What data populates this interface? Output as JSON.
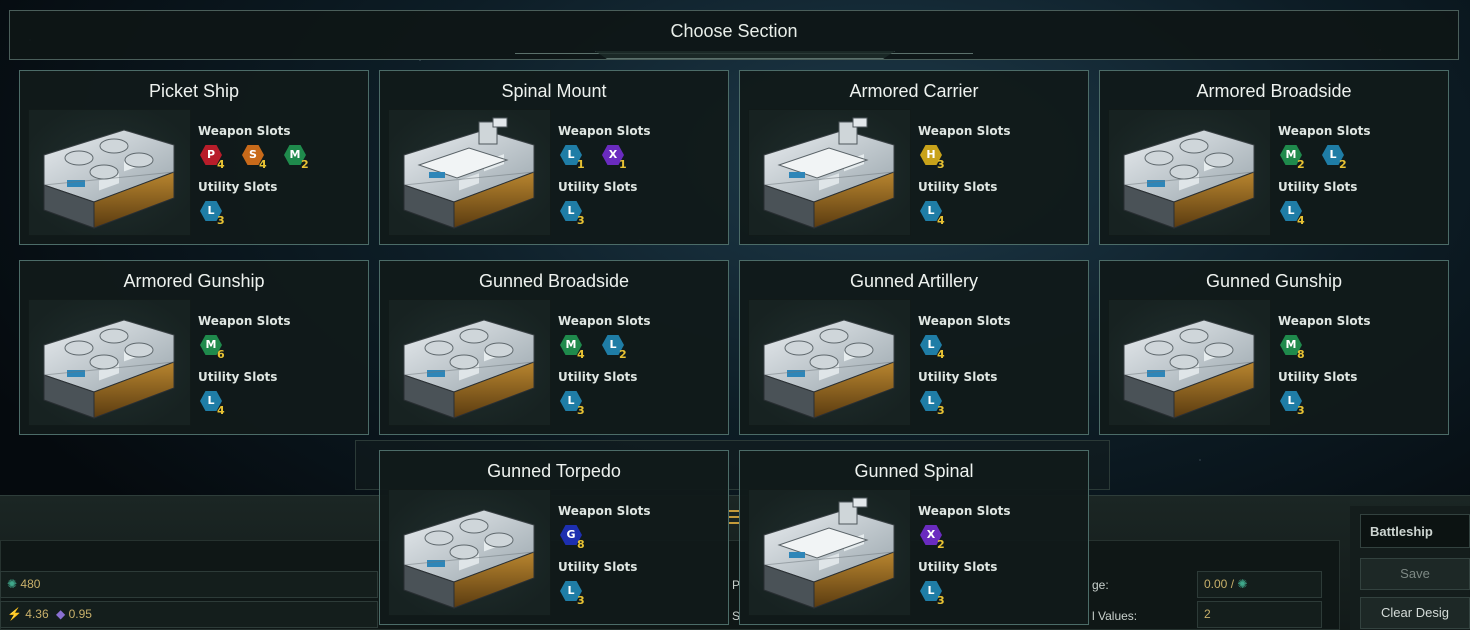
{
  "colors": {
    "P": "#b81d2a",
    "S": "#c86a1a",
    "M": "#1f8a4c",
    "L": "#1f7da6",
    "X": "#6a2bbf",
    "H": "#c8a21a",
    "G": "#1d2fb0"
  },
  "header": {
    "title": "Choose Section"
  },
  "labels": {
    "weapon_slots": "Weapon Slots",
    "utility_slots": "Utility Slots"
  },
  "sections": [
    {
      "name": "Picket Ship",
      "image": "compact-hull",
      "weapons": [
        {
          "type": "P",
          "count": "4"
        },
        {
          "type": "S",
          "count": "4"
        },
        {
          "type": "M",
          "count": "2"
        }
      ],
      "utility": [
        {
          "type": "L",
          "count": "3"
        }
      ]
    },
    {
      "name": "Spinal Mount",
      "image": "turret-hull",
      "weapons": [
        {
          "type": "L",
          "count": "1"
        },
        {
          "type": "X",
          "count": "1"
        }
      ],
      "utility": [
        {
          "type": "L",
          "count": "3"
        }
      ]
    },
    {
      "name": "Armored Carrier",
      "image": "turret-hull",
      "weapons": [
        {
          "type": "H",
          "count": "3"
        }
      ],
      "utility": [
        {
          "type": "L",
          "count": "4"
        }
      ]
    },
    {
      "name": "Armored Broadside",
      "image": "compact-hull",
      "weapons": [
        {
          "type": "M",
          "count": "2"
        },
        {
          "type": "L",
          "count": "2"
        }
      ],
      "utility": [
        {
          "type": "L",
          "count": "4"
        }
      ]
    },
    {
      "name": "Armored Gunship",
      "image": "compact-hull",
      "weapons": [
        {
          "type": "M",
          "count": "6"
        }
      ],
      "utility": [
        {
          "type": "L",
          "count": "4"
        }
      ]
    },
    {
      "name": "Gunned Broadside",
      "image": "compact-hull",
      "weapons": [
        {
          "type": "M",
          "count": "4"
        },
        {
          "type": "L",
          "count": "2"
        }
      ],
      "utility": [
        {
          "type": "L",
          "count": "3"
        }
      ]
    },
    {
      "name": "Gunned Artillery",
      "image": "compact-hull",
      "weapons": [
        {
          "type": "L",
          "count": "4"
        }
      ],
      "utility": [
        {
          "type": "L",
          "count": "3"
        }
      ]
    },
    {
      "name": "Gunned Gunship",
      "image": "compact-hull",
      "weapons": [
        {
          "type": "M",
          "count": "8"
        }
      ],
      "utility": [
        {
          "type": "L",
          "count": "3"
        }
      ]
    },
    {
      "name": "Gunned Torpedo",
      "image": "compact-hull",
      "weapons": [
        {
          "type": "G",
          "count": "8"
        }
      ],
      "utility": [
        {
          "type": "L",
          "count": "3"
        }
      ]
    },
    {
      "name": "Gunned Spinal",
      "image": "turret-hull",
      "weapons": [
        {
          "type": "X",
          "count": "2"
        }
      ],
      "utility": [
        {
          "type": "L",
          "count": "3"
        }
      ]
    }
  ],
  "background": {
    "stat_1": "480",
    "stat_2": "4.36",
    "stat_3": "0.95",
    "frag_p": "P",
    "frag_s": "S",
    "frag_ge": "ge:",
    "frag_values": "l Values:",
    "value_1": "0.00 /",
    "value_2": "2",
    "design_class": "Battleship",
    "save_label": "Save",
    "clear_label": "Clear Desig"
  }
}
